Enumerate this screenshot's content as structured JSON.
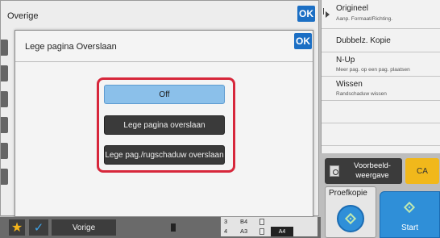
{
  "back_panel": {
    "title": "Overige",
    "ok_label": "OK"
  },
  "dialog": {
    "title": "Lege pagina Overslaan",
    "ok_label": "OK",
    "options": [
      {
        "label": "Off",
        "selected": true
      },
      {
        "label": "Lege pagina overslaan",
        "selected": false
      },
      {
        "label": "Lege pag./rugschaduw overslaan",
        "selected": false
      }
    ]
  },
  "right_menu": {
    "items": [
      {
        "title": "Origineel",
        "subtitle": "Aanp. Formaat/Richting."
      },
      {
        "title": "Dubbelz. Kopie",
        "subtitle": ""
      },
      {
        "title": "N-Up",
        "subtitle": "Meer pag. op een pag. plaatsen"
      },
      {
        "title": "Wissen",
        "subtitle": "Randschaduw wissen"
      }
    ]
  },
  "actions": {
    "preview_label": "Voorbeeld-weergave",
    "preview_line1": "Voorbeeld-",
    "preview_line2": "weergave",
    "ca_label": "CA",
    "proof_label": "Proefkopie",
    "start_label": "Start"
  },
  "bottom_bar": {
    "vorige_label": "Vorige",
    "trays": [
      {
        "number": "3",
        "size": "B4"
      },
      {
        "number": "4",
        "size": "A3"
      }
    ],
    "active_paper": "A4"
  },
  "colors": {
    "ok_blue": "#1c6fc4",
    "highlight_red": "#d7273b",
    "selected_option": "#8bc0ea",
    "start_blue": "#2f8fd8",
    "ca_yellow": "#f1b81b"
  }
}
